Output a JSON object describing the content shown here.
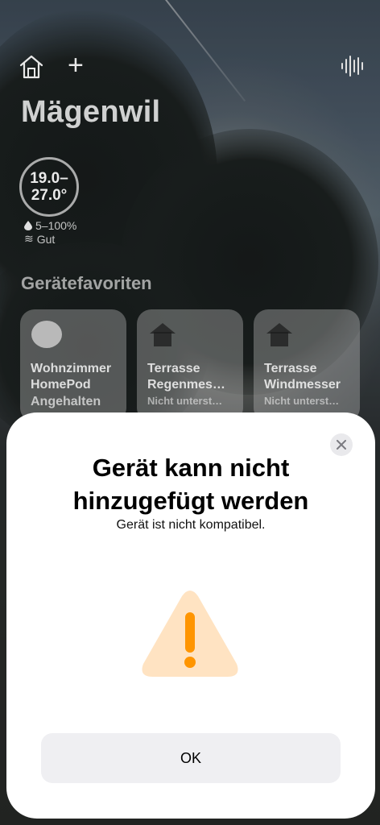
{
  "home": {
    "title": "Mägenwil",
    "weather": {
      "temp_min": "19.0–",
      "temp_max": "27.0°",
      "humidity": "5–100%",
      "air_quality": "Gut"
    },
    "favorites_title": "Gerätefavoriten",
    "tiles": [
      {
        "name_line1": "Wohnzimmer",
        "name_line2": "HomePod",
        "status": "Angehalten",
        "icon": "homepod-mini-icon"
      },
      {
        "name_line1": "Terrasse",
        "name_line2": "Regenmes…",
        "status": "Nicht unterst…",
        "icon": "house-icon"
      },
      {
        "name_line1": "Terrasse",
        "name_line2": "Windmesser",
        "status": "Nicht unterst…",
        "icon": "house-icon"
      }
    ]
  },
  "toolbar": {
    "home_icon": "home-icon",
    "add_icon": "plus-icon",
    "siri_icon": "waveform-icon",
    "add_glyph": "+"
  },
  "dialog": {
    "title": "Gerät kann nicht hinzugefügt werden",
    "subtitle": "Gerät ist nicht kompatibel.",
    "ok_label": "OK",
    "icon": "warning-icon",
    "warning_color": "#ff9500",
    "warning_fill": "#ffe3c2"
  }
}
